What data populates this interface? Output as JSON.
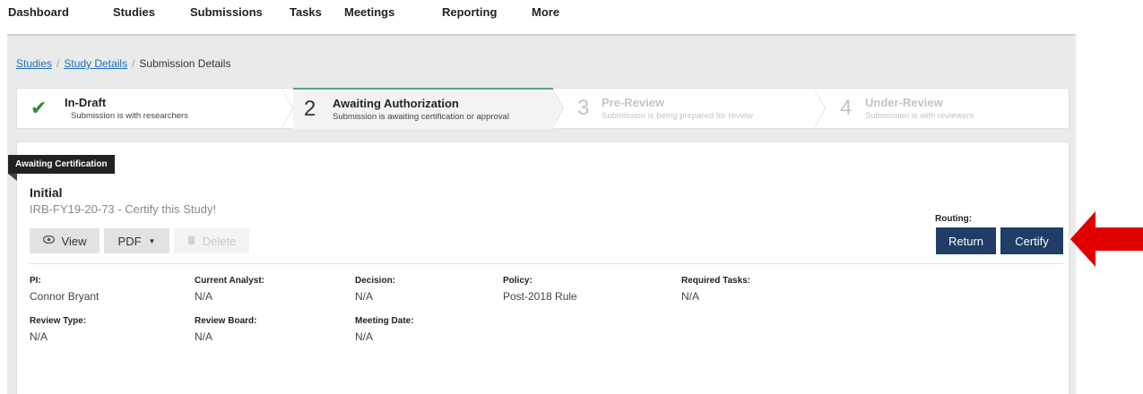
{
  "nav": {
    "items": [
      "Dashboard",
      "Studies",
      "Submissions",
      "Tasks",
      "Meetings",
      "Reporting",
      "More"
    ]
  },
  "breadcrumb": {
    "items": [
      {
        "label": "Studies",
        "link": true
      },
      {
        "label": "Study Details",
        "link": true
      },
      {
        "label": "Submission Details",
        "link": false
      }
    ],
    "separator": "/"
  },
  "stepper": {
    "steps": [
      {
        "marker": "✔",
        "title": "In-Draft",
        "subtitle": "Submission is with researchers",
        "state": "complete"
      },
      {
        "marker": "2",
        "title": "Awaiting Authorization",
        "subtitle": "Submission is awaiting certification or approval",
        "state": "active"
      },
      {
        "marker": "3",
        "title": "Pre-Review",
        "subtitle": "Submission is being prepared for review",
        "state": "disabled"
      },
      {
        "marker": "4",
        "title": "Under-Review",
        "subtitle": "Submission is with reviewers",
        "state": "disabled"
      }
    ]
  },
  "submission": {
    "status_badge": "Awaiting Certification",
    "title": "Initial",
    "identifier": "IRB-FY19-20-73 - Certify this Study!",
    "actions": {
      "view": "View",
      "pdf": "PDF",
      "delete": "Delete"
    },
    "routing": {
      "label": "Routing:",
      "return": "Return",
      "certify": "Certify"
    },
    "details": {
      "pi_label": "PI:",
      "pi_value": "Connor Bryant",
      "analyst_label": "Current Analyst:",
      "analyst_value": "N/A",
      "decision_label": "Decision:",
      "decision_value": "N/A",
      "policy_label": "Policy:",
      "policy_value": "Post-2018 Rule",
      "tasks_label": "Required Tasks:",
      "tasks_value": "N/A",
      "review_type_label": "Review Type:",
      "review_type_value": "N/A",
      "review_board_label": "Review Board:",
      "review_board_value": "N/A",
      "meeting_date_label": "Meeting Date:",
      "meeting_date_value": "N/A"
    }
  },
  "colors": {
    "primary_button": "#1f3d66",
    "check": "#2e8b3e",
    "link": "#1f6fbd",
    "annotation_arrow": "#e00000"
  }
}
